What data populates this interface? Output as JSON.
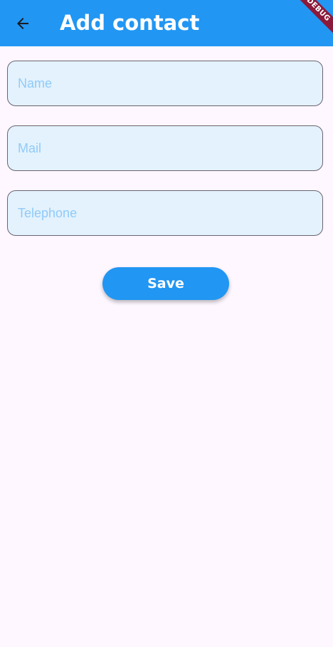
{
  "colors": {
    "appbar": "#2196F3",
    "background": "#FEF7FF",
    "field_fill": "#E3F2FD",
    "placeholder": "#90CAF9",
    "button": "#2196F3",
    "debug_banner": "#8B1A3A"
  },
  "appbar": {
    "title": "Add contact",
    "back_icon": "arrow-back-icon"
  },
  "debug_banner": {
    "label": "DEBUG"
  },
  "form": {
    "name": {
      "placeholder": "Name",
      "value": ""
    },
    "mail": {
      "placeholder": "Mail",
      "value": ""
    },
    "telephone": {
      "placeholder": "Telephone",
      "value": ""
    },
    "save_label": "Save"
  }
}
